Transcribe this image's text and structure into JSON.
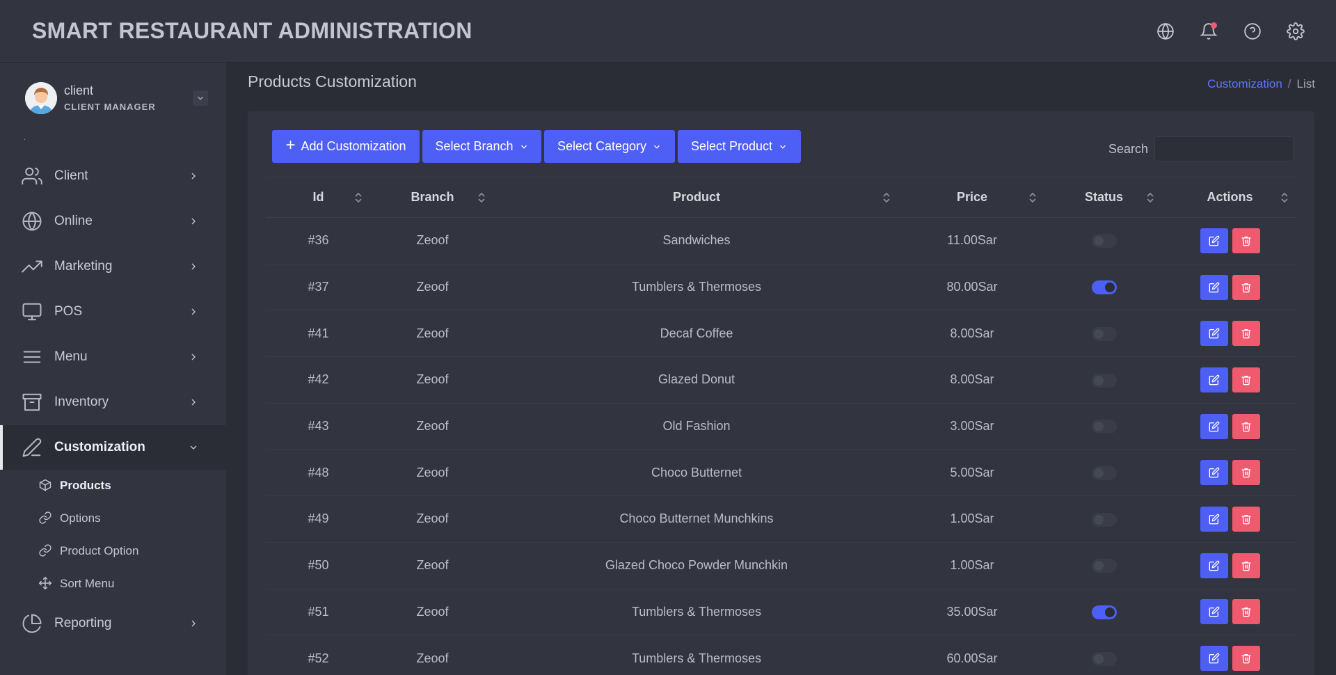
{
  "app": {
    "title": "SMART RESTAURANT ADMINISTRATION"
  },
  "header_icons": [
    "globe-icon",
    "bell-icon",
    "help-icon",
    "gear-icon"
  ],
  "user": {
    "name": "client",
    "role": "CLIENT MANAGER"
  },
  "sidebar": {
    "items": [
      {
        "label": "Client",
        "icon": "users-icon"
      },
      {
        "label": "Online",
        "icon": "globe-icon"
      },
      {
        "label": "Marketing",
        "icon": "trending-icon"
      },
      {
        "label": "POS",
        "icon": "monitor-icon"
      },
      {
        "label": "Menu",
        "icon": "menu-icon"
      },
      {
        "label": "Inventory",
        "icon": "archive-icon"
      },
      {
        "label": "Customization",
        "icon": "pen-icon",
        "active": true
      },
      {
        "label": "Reporting",
        "icon": "pie-chart-icon"
      }
    ],
    "subitems": [
      {
        "label": "Products",
        "icon": "box-icon",
        "active": true
      },
      {
        "label": "Options",
        "icon": "link-icon"
      },
      {
        "label": "Product Option",
        "icon": "link-icon"
      },
      {
        "label": "Sort Menu",
        "icon": "move-icon"
      }
    ]
  },
  "page": {
    "title": "Products Customization",
    "breadcrumb": {
      "link": "Customization",
      "separator": "/",
      "current": "List"
    }
  },
  "toolbar": {
    "add_label": "Add Customization",
    "branch_label": "Select Branch",
    "category_label": "Select Category",
    "product_label": "Select Product",
    "search_label": "Search",
    "search_value": ""
  },
  "table": {
    "headers": {
      "id": "Id",
      "branch": "Branch",
      "product": "Product",
      "price": "Price",
      "status": "Status",
      "actions": "Actions"
    },
    "rows": [
      {
        "id": "#36",
        "branch": "Zeoof",
        "product": "Sandwiches",
        "price": "11.00Sar",
        "status": false
      },
      {
        "id": "#37",
        "branch": "Zeoof",
        "product": "Tumblers & Thermoses",
        "price": "80.00Sar",
        "status": true
      },
      {
        "id": "#41",
        "branch": "Zeoof",
        "product": "Decaf Coffee",
        "price": "8.00Sar",
        "status": false
      },
      {
        "id": "#42",
        "branch": "Zeoof",
        "product": "Glazed Donut",
        "price": "8.00Sar",
        "status": false
      },
      {
        "id": "#43",
        "branch": "Zeoof",
        "product": "Old Fashion",
        "price": "3.00Sar",
        "status": false
      },
      {
        "id": "#48",
        "branch": "Zeoof",
        "product": "Choco Butternet",
        "price": "5.00Sar",
        "status": false
      },
      {
        "id": "#49",
        "branch": "Zeoof",
        "product": "Choco Butternet Munchkins",
        "price": "1.00Sar",
        "status": false
      },
      {
        "id": "#50",
        "branch": "Zeoof",
        "product": "Glazed Choco Powder Munchkin",
        "price": "1.00Sar",
        "status": false
      },
      {
        "id": "#51",
        "branch": "Zeoof",
        "product": "Tumblers & Thermoses",
        "price": "35.00Sar",
        "status": true
      },
      {
        "id": "#52",
        "branch": "Zeoof",
        "product": "Tumblers & Thermoses",
        "price": "60.00Sar",
        "status": false
      }
    ]
  },
  "colors": {
    "accent": "#4d5ff5",
    "danger": "#f05a6e",
    "header_bg": "#323540",
    "body_bg": "#2a2d36"
  }
}
